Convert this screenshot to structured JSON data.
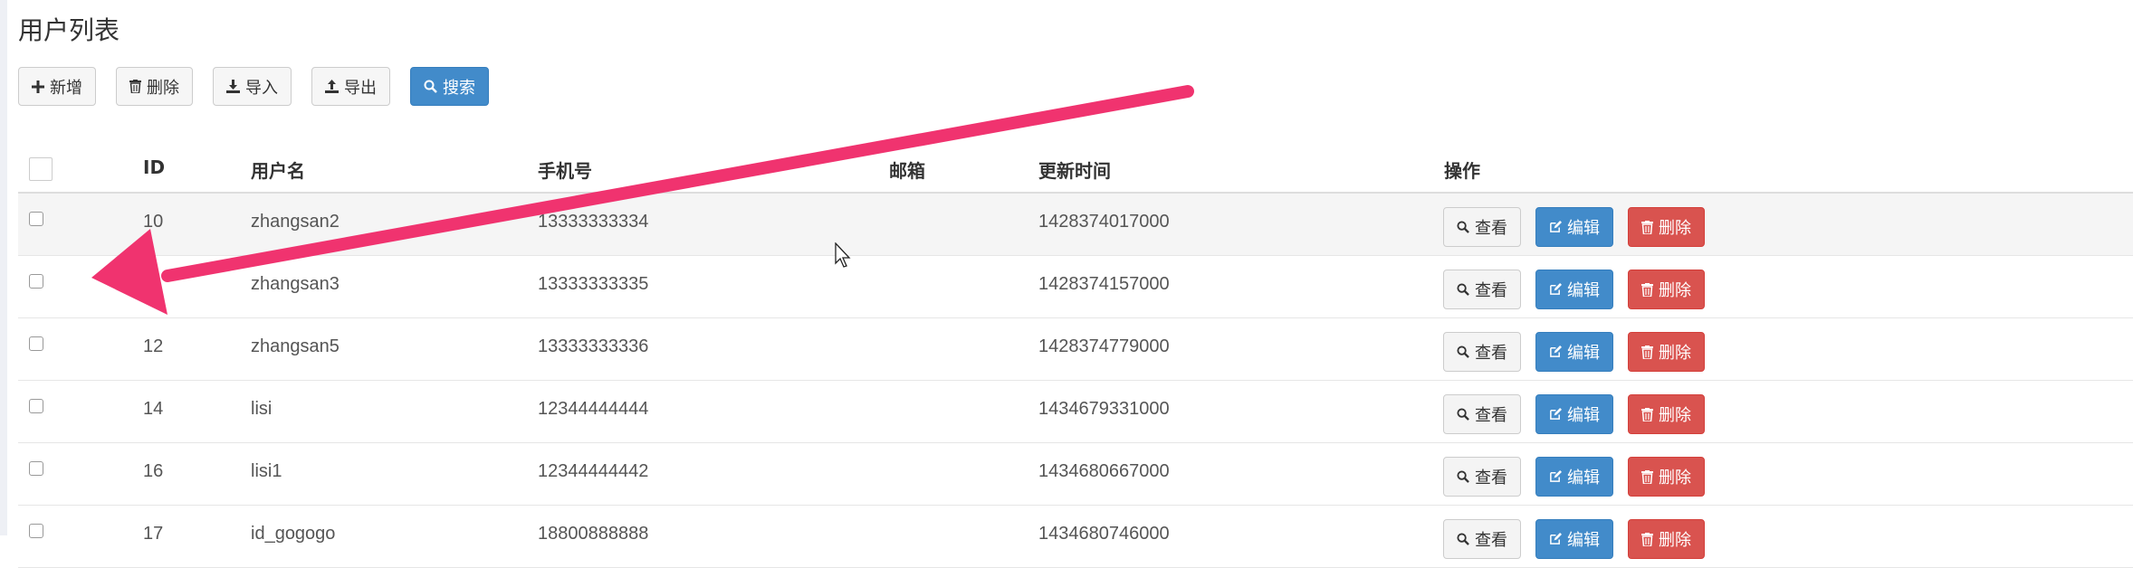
{
  "page": {
    "title": "用户列表"
  },
  "toolbar": {
    "add_label": "新增",
    "delete_label": "删除",
    "import_label": "导入",
    "export_label": "导出",
    "search_label": "搜索"
  },
  "table": {
    "headers": {
      "id": "ID",
      "username": "用户名",
      "phone": "手机号",
      "email": "邮箱",
      "updated": "更新时间",
      "actions": "操作"
    },
    "action_labels": {
      "view": "查看",
      "edit": "编辑",
      "delete": "删除"
    },
    "rows": [
      {
        "id": "10",
        "username": "zhangsan2",
        "phone": "13333333334",
        "email": "",
        "updated": "1428374017000"
      },
      {
        "id": "",
        "username": "zhangsan3",
        "phone": "13333333335",
        "email": "",
        "updated": "1428374157000"
      },
      {
        "id": "12",
        "username": "zhangsan5",
        "phone": "13333333336",
        "email": "",
        "updated": "1428374779000"
      },
      {
        "id": "14",
        "username": "lisi",
        "phone": "12344444444",
        "email": "",
        "updated": "1434679331000"
      },
      {
        "id": "16",
        "username": "lisi1",
        "phone": "12344444442",
        "email": "",
        "updated": "1434680667000"
      },
      {
        "id": "17",
        "username": "id_gogogo",
        "phone": "18800888888",
        "email": "",
        "updated": "1434680746000"
      }
    ]
  },
  "icons": {
    "add": "plus-icon",
    "delete": "trash-icon",
    "import": "download-icon",
    "export": "upload-icon",
    "search": "search-icon",
    "view": "search-icon",
    "edit": "edit-icon"
  },
  "colors": {
    "primary": "#428bca",
    "danger": "#d9534f",
    "annotation_arrow": "#f0336f"
  }
}
